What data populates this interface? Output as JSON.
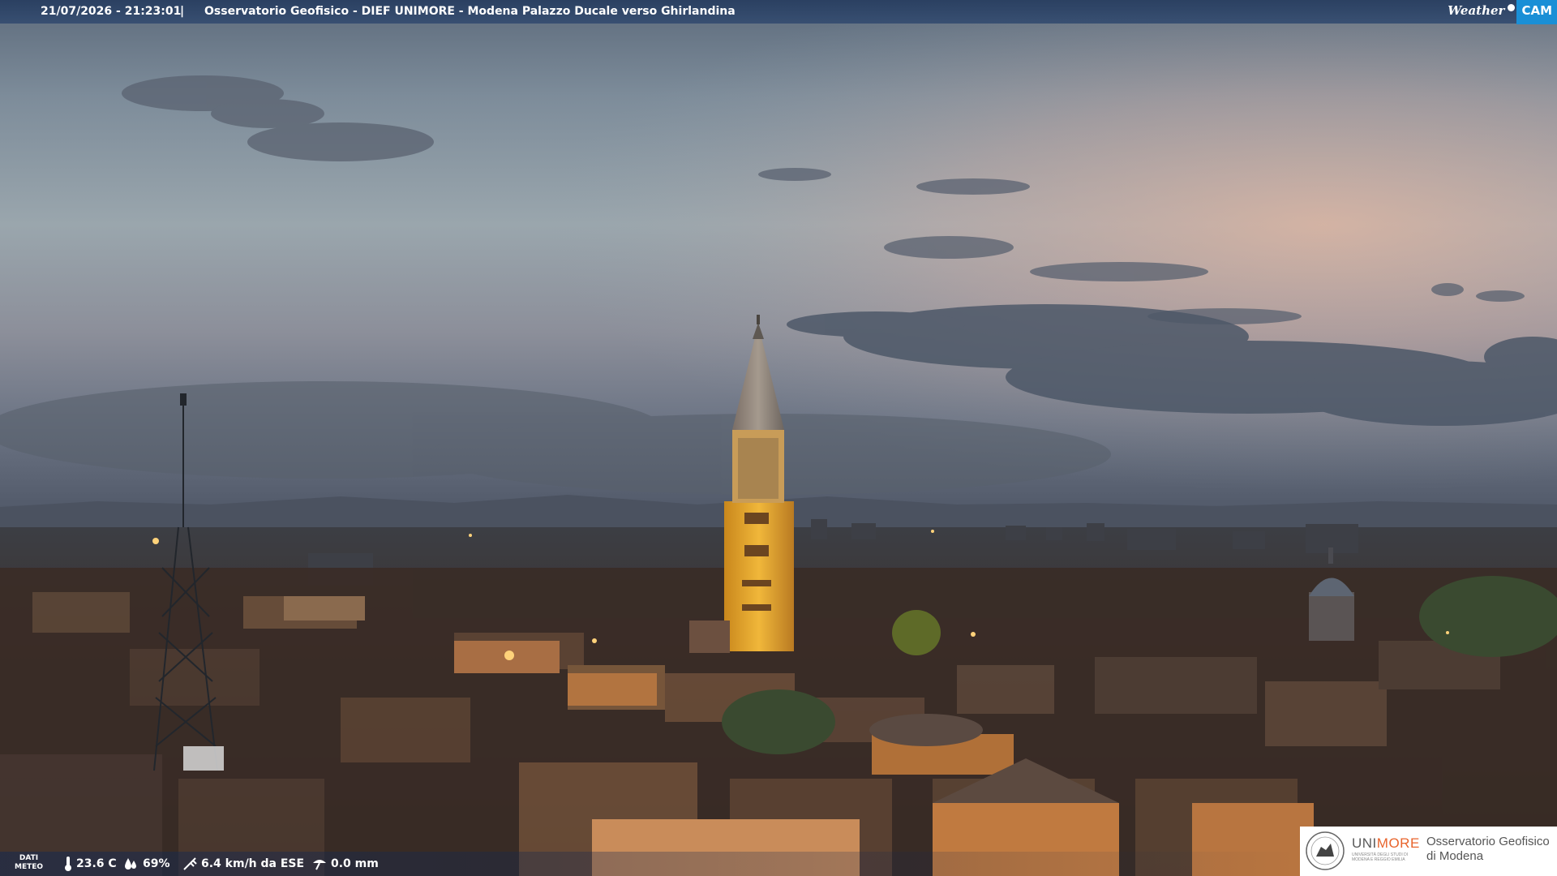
{
  "header": {
    "timestamp": "21/07/2026 - 21:23:01",
    "separator": "|",
    "camera_title": "Osservatorio Geofisico - DIEF UNIMORE - Modena Palazzo Ducale verso Ghirlandina",
    "logo_weather": "Weather",
    "logo_cam": "CAM"
  },
  "meteo": {
    "label_line1": "DATI",
    "label_line2": "METEO",
    "temperature": "23.6 C",
    "humidity": "69%",
    "wind": "6.4 km/h da ESE",
    "rain": "0.0 mm"
  },
  "branding": {
    "name_uni": "UNI",
    "name_more": "MORE",
    "subtitle": "UNIVERSITÀ DEGLI STUDI DI MODENA E REGGIO EMILIA",
    "org_line1": "Osservatorio Geofisico",
    "org_line2": "di Modena"
  },
  "colors": {
    "banner": "#2c4670",
    "cam_accent": "#1a8fd6",
    "brand_orange": "#e8642c"
  },
  "icons": [
    "thermometer-icon",
    "humidity-drop-icon",
    "wind-icon",
    "rain-gauge-icon"
  ]
}
